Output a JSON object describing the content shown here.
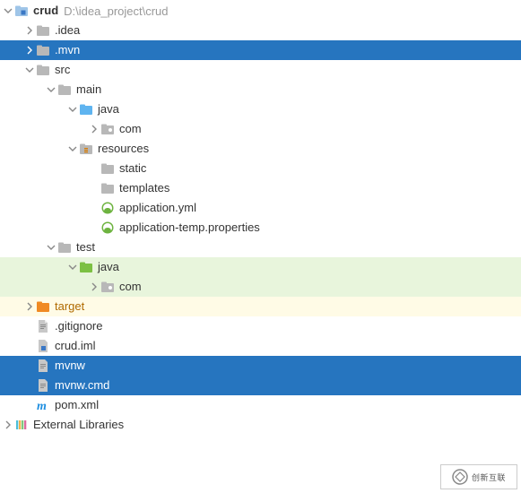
{
  "root": {
    "name": "crud",
    "path": "D:\\idea_project\\crud"
  },
  "n": {
    "idea": ".idea",
    "mvn": ".mvn",
    "src": "src",
    "main": "main",
    "java": "java",
    "com": "com",
    "resources": "resources",
    "static": "static",
    "templates": "templates",
    "appyml": "application.yml",
    "apptemp": "application-temp.properties",
    "test": "test",
    "java2": "java",
    "com2": "com",
    "target": "target",
    "gitignore": ".gitignore",
    "crudiml": "crud.iml",
    "mvnw": "mvnw",
    "mvnwcmd": "mvnw.cmd",
    "pom": "pom.xml",
    "extlib": "External Libraries"
  },
  "watermark": "创新互联"
}
